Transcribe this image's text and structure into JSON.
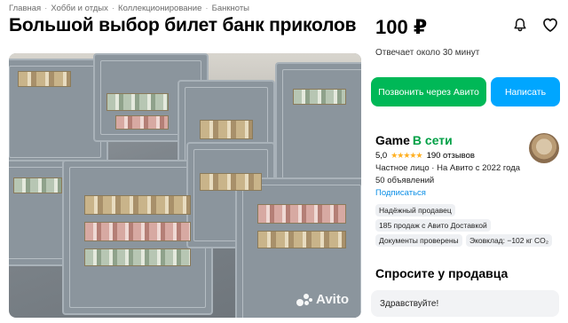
{
  "breadcrumb": [
    "Главная",
    "Хобби и отдых",
    "Коллекционирование",
    "Банкноты"
  ],
  "listing": {
    "title": "Большой выбор билет банк приколов",
    "price": "100 ₽",
    "response_time": "Отвечает около 30 минут",
    "photo_watermark": "Avito"
  },
  "actions": {
    "call_label": "Позвонить через Авито",
    "write_label": "Написать"
  },
  "seller": {
    "name": "Game",
    "online_label": "В сети",
    "rating": "5,0",
    "stars": "★★★★★",
    "reviews": "190 отзывов",
    "type_line": "Частное лицо · На Авито с 2022 года",
    "ads_count": "50 объявлений",
    "subscribe_label": "Подписаться"
  },
  "badges": [
    "Надёжный продавец",
    "185 продаж с Авито Доставкой",
    "Документы проверены",
    "Эковклад: −102 кг CO₂"
  ],
  "chat": {
    "title": "Спросите у продавца",
    "message_value": "Здравствуйте!"
  },
  "colors": {
    "call_button": "#00b857",
    "write_button": "#00a6ff",
    "online": "#00a046",
    "link": "#0a8ee6",
    "stars": "#ffb021"
  }
}
